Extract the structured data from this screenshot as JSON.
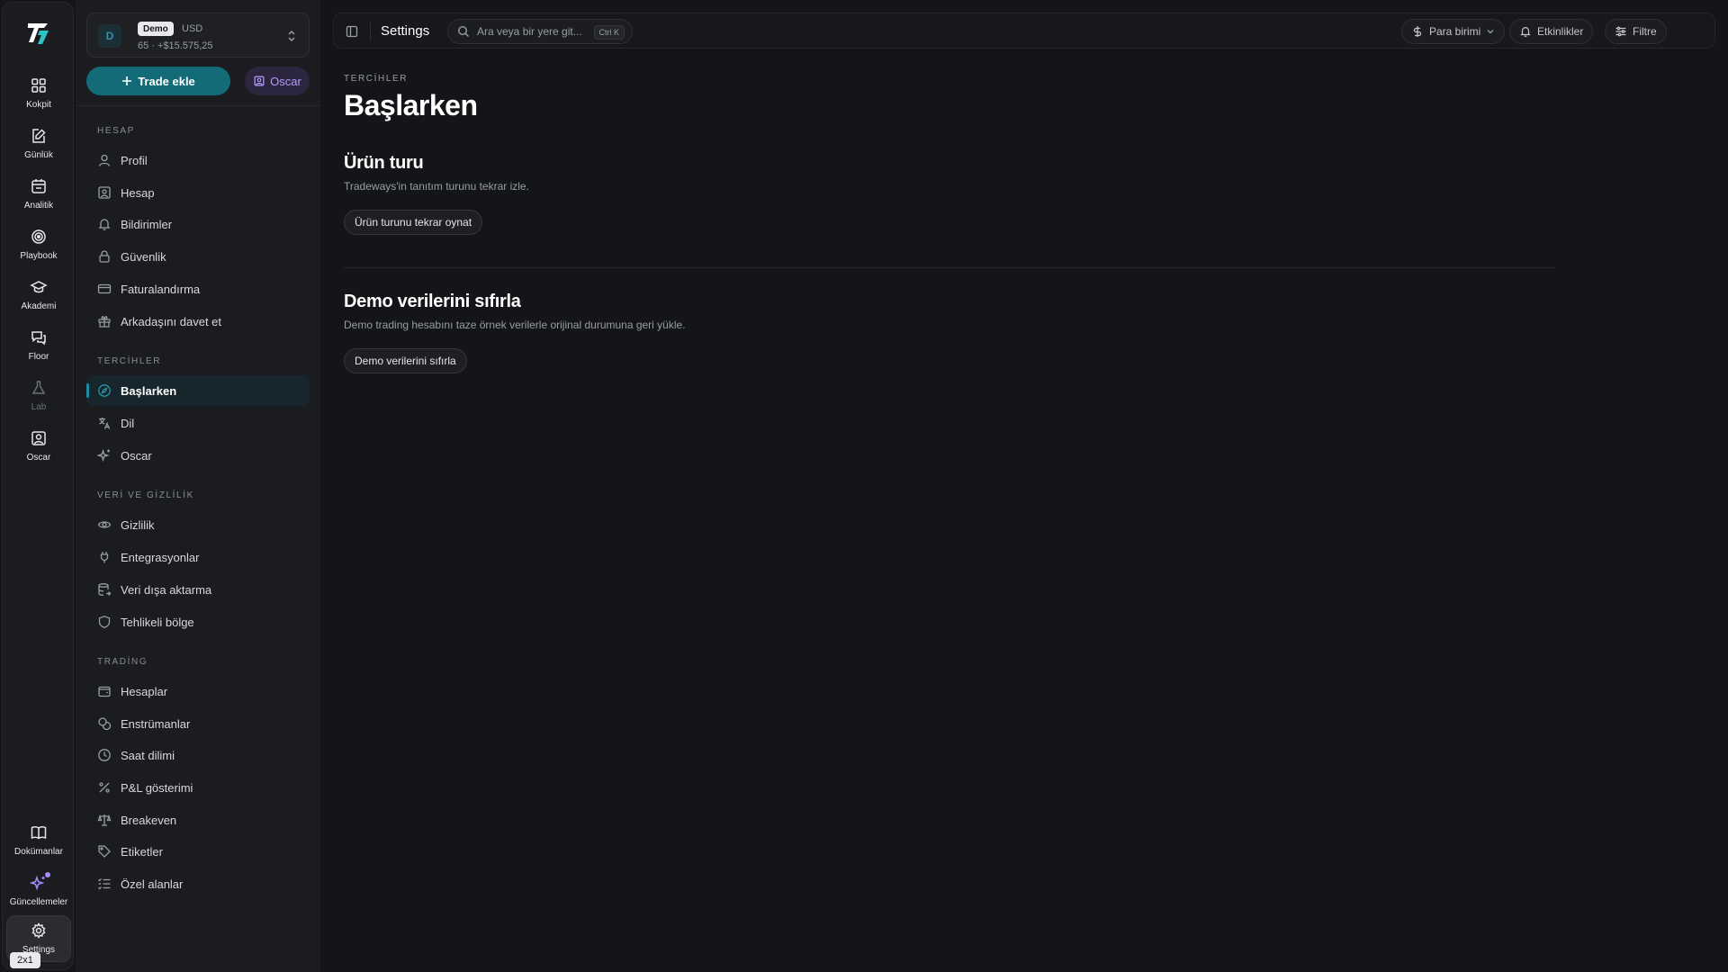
{
  "rail": {
    "items": [
      {
        "label": "Kokpit",
        "icon": "dashboard-icon"
      },
      {
        "label": "Günlük",
        "icon": "journal-edit-icon"
      },
      {
        "label": "Analitik",
        "icon": "calendar-chart-icon"
      },
      {
        "label": "Playbook",
        "icon": "target-icon"
      },
      {
        "label": "Akademi",
        "icon": "graduation-cap-icon"
      },
      {
        "label": "Floor",
        "icon": "chat-bubbles-icon"
      },
      {
        "label": "Lab",
        "icon": "flask-icon"
      },
      {
        "label": "Oscar",
        "icon": "user-square-icon"
      }
    ],
    "bottom": [
      {
        "label": "Dokümanlar",
        "icon": "book-open-icon"
      },
      {
        "label": "Güncellemeler",
        "icon": "sparkles-icon"
      },
      {
        "label": "Settings",
        "icon": "gear-icon"
      }
    ],
    "badge": "2x1"
  },
  "account": {
    "avatar": "D",
    "tag": "Demo",
    "currency": "USD",
    "summary": "65 · +$15.575,25"
  },
  "actions": {
    "trade_label": "Trade ekle",
    "oscar_label": "Oscar"
  },
  "sidebar": {
    "sections": [
      {
        "title": "HESAP",
        "items": [
          "Profil",
          "Hesap",
          "Bildirimler",
          "Güvenlik",
          "Faturalandırma",
          "Arkadaşını davet et"
        ]
      },
      {
        "title": "TERCİHLER",
        "items": [
          "Başlarken",
          "Dil",
          "Oscar"
        ]
      },
      {
        "title": "VERİ VE GİZLİLİK",
        "items": [
          "Gizlilik",
          "Entegrasyonlar",
          "Veri dışa aktarma",
          "Tehlikeli bölge"
        ]
      },
      {
        "title": "TRADİNG",
        "items": [
          "Hesaplar",
          "Enstrümanlar",
          "Saat dilimi",
          "P&L gösterimi",
          "Breakeven",
          "Etiketler",
          "Özel alanlar"
        ]
      }
    ],
    "active": "Başlarken"
  },
  "topbar": {
    "title": "Settings",
    "search_placeholder": "Ara veya bir yere git...",
    "shortcut": "Ctrl K",
    "currency_label": "Para birimi",
    "events_label": "Etkinlikler",
    "filter_label": "Filtre"
  },
  "page": {
    "eyebrow": "TERCİHLER",
    "title": "Başlarken",
    "tour": {
      "title": "Ürün turu",
      "description": "Tradeways'in tanıtım turunu tekrar izle.",
      "button": "Ürün turunu tekrar oynat"
    },
    "demo": {
      "title": "Demo verilerini sıfırla",
      "description": "Demo trading hesabını taze örnek verilerle orijinal durumuna geri yükle.",
      "button": "Demo verilerini sıfırla"
    }
  },
  "colors": {
    "accent": "#136b78",
    "oscar_purple": "#b69cf8",
    "background": "#141518",
    "sidebar": "#1b1c20"
  }
}
